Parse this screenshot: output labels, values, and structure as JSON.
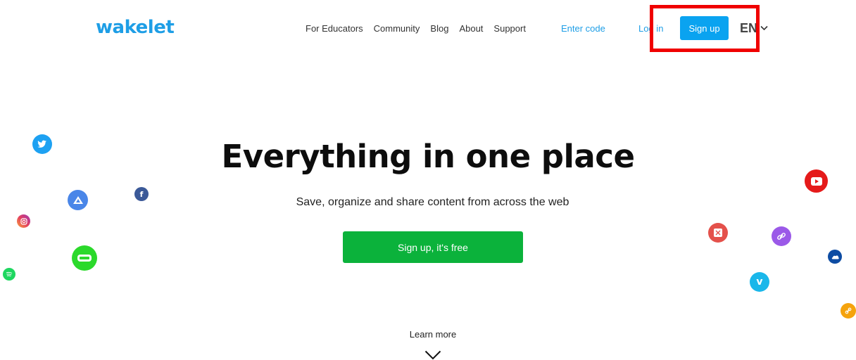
{
  "header": {
    "logo": "wakelet",
    "nav": [
      "For Educators",
      "Community",
      "Blog",
      "About",
      "Support"
    ],
    "enter_code": "Enter code",
    "login": "Log in",
    "signup": "Sign up",
    "language": "EN"
  },
  "hero": {
    "title": "Everything in one place",
    "subtitle": "Save, organize and share content from across the web",
    "cta": "Sign up, it's free"
  },
  "learn_more": "Learn more",
  "colors": {
    "brand": "#1e9ee6",
    "signup_bg": "#0aa3f0",
    "cta_bg": "#0bb23b",
    "highlight": "#f00000"
  },
  "floating_icons": [
    "twitter-icon",
    "google-drive-icon",
    "facebook-icon",
    "instagram-icon",
    "flipgrid-icon",
    "spotify-icon",
    "youtube-icon",
    "maps-icon",
    "link-icon",
    "onedrive-icon",
    "vimeo-icon",
    "orange-link-icon"
  ]
}
